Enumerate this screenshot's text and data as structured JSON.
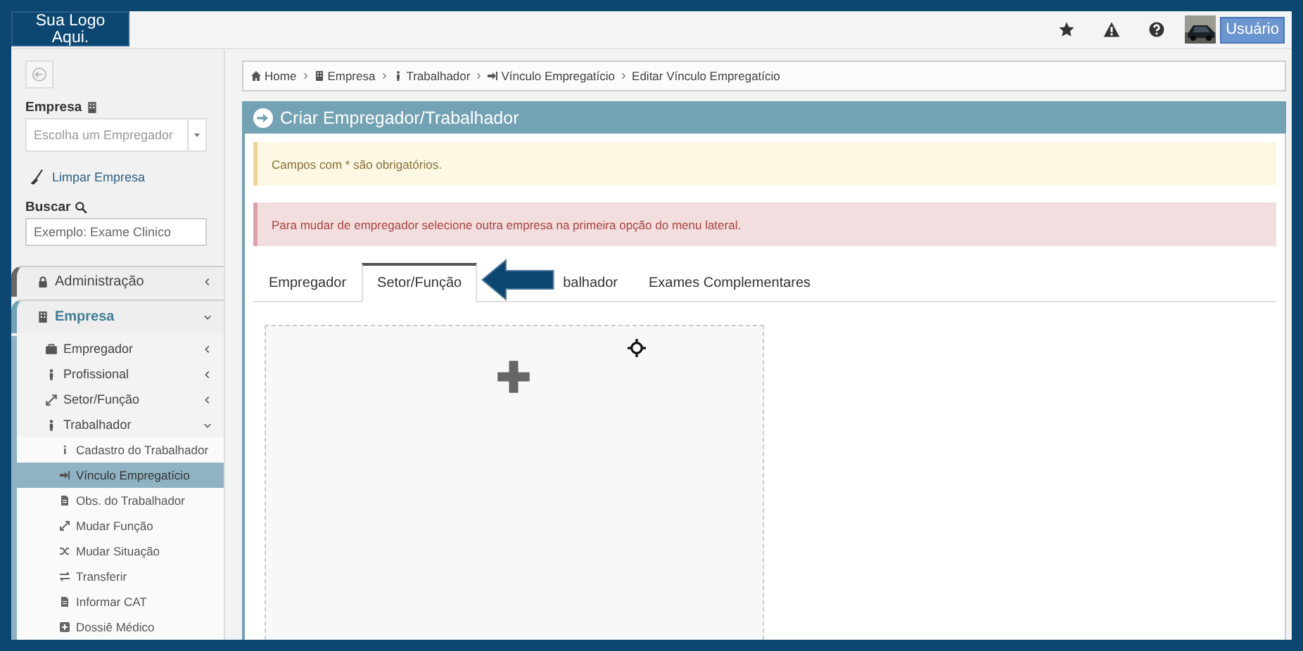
{
  "logo": {
    "text": "Sua Logo Aqui."
  },
  "topbar": {
    "user_button": "Usuário"
  },
  "sidebar": {
    "empresa_label": "Empresa",
    "empresa_select": {
      "placeholder": "Escolha um Empregador"
    },
    "clear_link": "Limpar Empresa",
    "search_label": "Buscar",
    "search_field": {
      "placeholder": "Exemplo: Exame Clinico"
    },
    "menu": [
      {
        "label": "Administração",
        "expanded": false
      },
      {
        "label": "Empresa",
        "expanded": true,
        "children": [
          {
            "label": "Empregador",
            "expanded": false
          },
          {
            "label": "Profissional",
            "expanded": false
          },
          {
            "label": "Setor/Função",
            "expanded": false
          },
          {
            "label": "Trabalhador",
            "expanded": true,
            "children": [
              {
                "label": "Cadastro do Trabalhador",
                "selected": false
              },
              {
                "label": "Vínculo Empregatício",
                "selected": true
              },
              {
                "label": "Obs. do Trabalhador",
                "selected": false
              },
              {
                "label": "Mudar Função",
                "selected": false
              },
              {
                "label": "Mudar Situação",
                "selected": false
              },
              {
                "label": "Transferir",
                "selected": false
              },
              {
                "label": "Informar CAT",
                "selected": false
              },
              {
                "label": "Dossiê Médico",
                "selected": false
              }
            ]
          }
        ]
      }
    ]
  },
  "breadcrumb": [
    "Home",
    "Empresa",
    "Trabalhador",
    "Vínculo Empregatício",
    "Editar Vínculo Empregatício"
  ],
  "panel": {
    "title": "Criar Empregador/Trabalhador",
    "alerts": [
      {
        "kind": "warning",
        "text": "Campos com * são obrigatórios."
      },
      {
        "kind": "danger",
        "text": "Para mudar de empregador selecione outra empresa na primeira opção do menu lateral."
      }
    ],
    "tabs": [
      {
        "label": "Empregador",
        "selected": false
      },
      {
        "label": "Setor/Função",
        "selected": true
      },
      {
        "label": "balhador",
        "selected": false
      },
      {
        "label": "Exames Complementares",
        "selected": false
      }
    ]
  }
}
